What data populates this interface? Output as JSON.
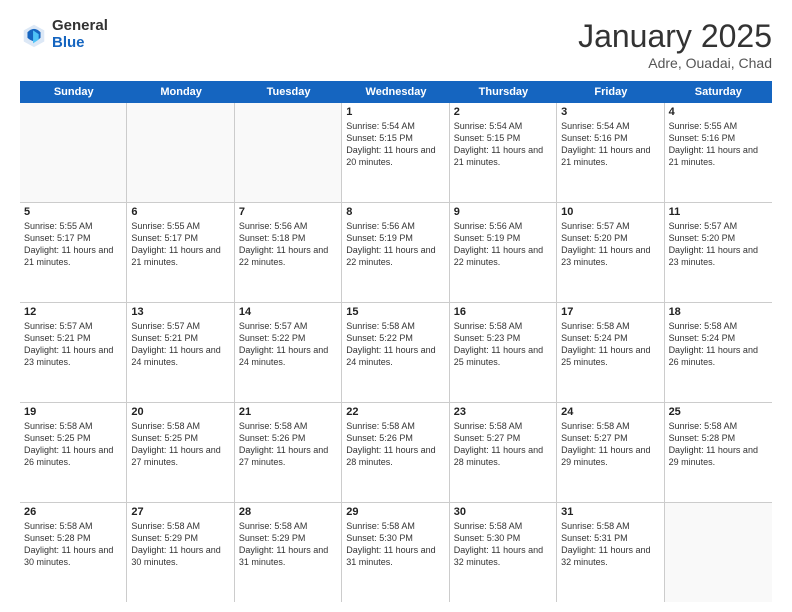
{
  "logo": {
    "general": "General",
    "blue": "Blue"
  },
  "header": {
    "month": "January 2025",
    "location": "Adre, Ouadai, Chad"
  },
  "days_of_week": [
    "Sunday",
    "Monday",
    "Tuesday",
    "Wednesday",
    "Thursday",
    "Friday",
    "Saturday"
  ],
  "weeks": [
    [
      {
        "day": "",
        "info": "",
        "empty": true
      },
      {
        "day": "",
        "info": "",
        "empty": true
      },
      {
        "day": "",
        "info": "",
        "empty": true
      },
      {
        "day": "1",
        "info": "Sunrise: 5:54 AM\nSunset: 5:15 PM\nDaylight: 11 hours\nand 20 minutes."
      },
      {
        "day": "2",
        "info": "Sunrise: 5:54 AM\nSunset: 5:15 PM\nDaylight: 11 hours\nand 21 minutes."
      },
      {
        "day": "3",
        "info": "Sunrise: 5:54 AM\nSunset: 5:16 PM\nDaylight: 11 hours\nand 21 minutes."
      },
      {
        "day": "4",
        "info": "Sunrise: 5:55 AM\nSunset: 5:16 PM\nDaylight: 11 hours\nand 21 minutes."
      }
    ],
    [
      {
        "day": "5",
        "info": "Sunrise: 5:55 AM\nSunset: 5:17 PM\nDaylight: 11 hours\nand 21 minutes."
      },
      {
        "day": "6",
        "info": "Sunrise: 5:55 AM\nSunset: 5:17 PM\nDaylight: 11 hours\nand 21 minutes."
      },
      {
        "day": "7",
        "info": "Sunrise: 5:56 AM\nSunset: 5:18 PM\nDaylight: 11 hours\nand 22 minutes."
      },
      {
        "day": "8",
        "info": "Sunrise: 5:56 AM\nSunset: 5:19 PM\nDaylight: 11 hours\nand 22 minutes."
      },
      {
        "day": "9",
        "info": "Sunrise: 5:56 AM\nSunset: 5:19 PM\nDaylight: 11 hours\nand 22 minutes."
      },
      {
        "day": "10",
        "info": "Sunrise: 5:57 AM\nSunset: 5:20 PM\nDaylight: 11 hours\nand 23 minutes."
      },
      {
        "day": "11",
        "info": "Sunrise: 5:57 AM\nSunset: 5:20 PM\nDaylight: 11 hours\nand 23 minutes."
      }
    ],
    [
      {
        "day": "12",
        "info": "Sunrise: 5:57 AM\nSunset: 5:21 PM\nDaylight: 11 hours\nand 23 minutes."
      },
      {
        "day": "13",
        "info": "Sunrise: 5:57 AM\nSunset: 5:21 PM\nDaylight: 11 hours\nand 24 minutes."
      },
      {
        "day": "14",
        "info": "Sunrise: 5:57 AM\nSunset: 5:22 PM\nDaylight: 11 hours\nand 24 minutes."
      },
      {
        "day": "15",
        "info": "Sunrise: 5:58 AM\nSunset: 5:22 PM\nDaylight: 11 hours\nand 24 minutes."
      },
      {
        "day": "16",
        "info": "Sunrise: 5:58 AM\nSunset: 5:23 PM\nDaylight: 11 hours\nand 25 minutes."
      },
      {
        "day": "17",
        "info": "Sunrise: 5:58 AM\nSunset: 5:24 PM\nDaylight: 11 hours\nand 25 minutes."
      },
      {
        "day": "18",
        "info": "Sunrise: 5:58 AM\nSunset: 5:24 PM\nDaylight: 11 hours\nand 26 minutes."
      }
    ],
    [
      {
        "day": "19",
        "info": "Sunrise: 5:58 AM\nSunset: 5:25 PM\nDaylight: 11 hours\nand 26 minutes."
      },
      {
        "day": "20",
        "info": "Sunrise: 5:58 AM\nSunset: 5:25 PM\nDaylight: 11 hours\nand 27 minutes."
      },
      {
        "day": "21",
        "info": "Sunrise: 5:58 AM\nSunset: 5:26 PM\nDaylight: 11 hours\nand 27 minutes."
      },
      {
        "day": "22",
        "info": "Sunrise: 5:58 AM\nSunset: 5:26 PM\nDaylight: 11 hours\nand 28 minutes."
      },
      {
        "day": "23",
        "info": "Sunrise: 5:58 AM\nSunset: 5:27 PM\nDaylight: 11 hours\nand 28 minutes."
      },
      {
        "day": "24",
        "info": "Sunrise: 5:58 AM\nSunset: 5:27 PM\nDaylight: 11 hours\nand 29 minutes."
      },
      {
        "day": "25",
        "info": "Sunrise: 5:58 AM\nSunset: 5:28 PM\nDaylight: 11 hours\nand 29 minutes."
      }
    ],
    [
      {
        "day": "26",
        "info": "Sunrise: 5:58 AM\nSunset: 5:28 PM\nDaylight: 11 hours\nand 30 minutes."
      },
      {
        "day": "27",
        "info": "Sunrise: 5:58 AM\nSunset: 5:29 PM\nDaylight: 11 hours\nand 30 minutes."
      },
      {
        "day": "28",
        "info": "Sunrise: 5:58 AM\nSunset: 5:29 PM\nDaylight: 11 hours\nand 31 minutes."
      },
      {
        "day": "29",
        "info": "Sunrise: 5:58 AM\nSunset: 5:30 PM\nDaylight: 11 hours\nand 31 minutes."
      },
      {
        "day": "30",
        "info": "Sunrise: 5:58 AM\nSunset: 5:30 PM\nDaylight: 11 hours\nand 32 minutes."
      },
      {
        "day": "31",
        "info": "Sunrise: 5:58 AM\nSunset: 5:31 PM\nDaylight: 11 hours\nand 32 minutes."
      },
      {
        "day": "",
        "info": "",
        "empty": true
      }
    ]
  ]
}
